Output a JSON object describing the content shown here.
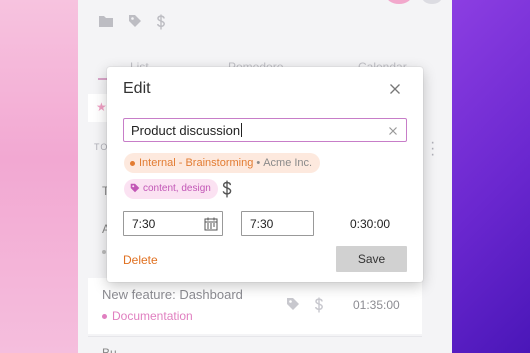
{
  "background_app": {
    "tabs": [
      {
        "label": "List"
      },
      {
        "label": "Pomodoro"
      },
      {
        "label": "Calendar"
      }
    ],
    "section_label": "TO",
    "row_fragments": [
      "T",
      "A",
      "Bu"
    ],
    "task": {
      "title": "New feature: Dashboard",
      "project": "Documentation",
      "duration": "01:35:00"
    }
  },
  "modal": {
    "title": "Edit",
    "description": "Product discussion",
    "project": {
      "name": "Internal - Brainstorming",
      "separator": "•",
      "client": "Acme Inc.",
      "color": "#e27c32"
    },
    "tags": "content, design",
    "start_time": "7:30",
    "end_time": "7:30",
    "duration": "0:30:00",
    "delete_label": "Delete",
    "save_label": "Save"
  },
  "colors": {
    "accent_pink": "#c77dc8",
    "delete_orange": "#e07020",
    "tag_pink": "#c256b6"
  },
  "icons": {
    "close": "close-icon",
    "clear": "clear-icon",
    "tag": "tag-icon",
    "dollar": "dollar-icon",
    "calendar": "calendar-icon",
    "folder": "folder-icon"
  }
}
